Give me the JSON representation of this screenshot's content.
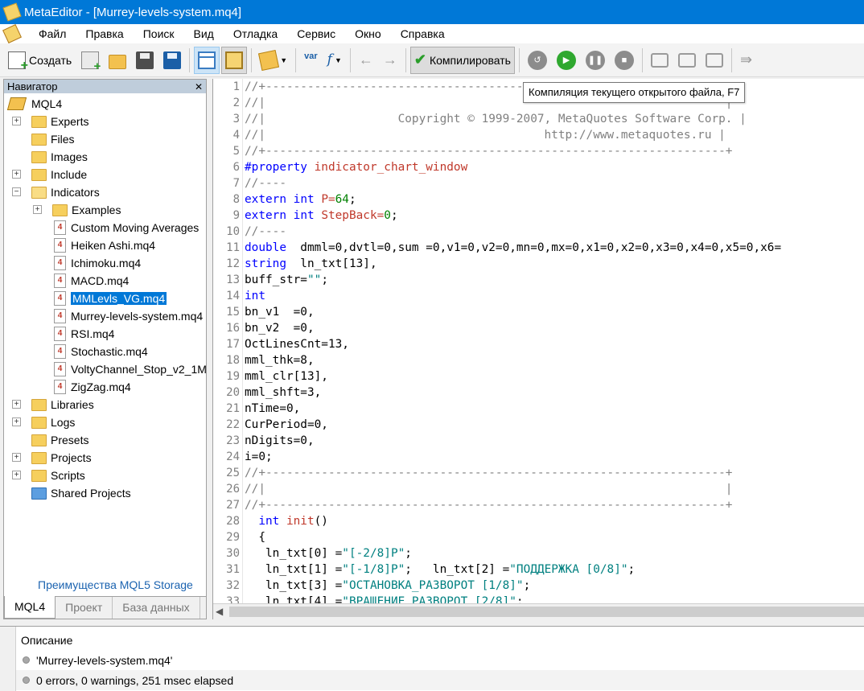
{
  "titlebar": {
    "title": "MetaEditor - [Murrey-levels-system.mq4]"
  },
  "menu": [
    "Файл",
    "Правка",
    "Поиск",
    "Вид",
    "Отладка",
    "Сервис",
    "Окно",
    "Справка"
  ],
  "toolbar": {
    "create_label": "Создать",
    "compile_label": "Компилировать",
    "tooltip": "Компиляция текущего открытого файла, F7",
    "var_label": "var",
    "func_label": "f"
  },
  "navigator": {
    "title": "Навигатор",
    "root": "MQL4",
    "folders": {
      "experts": "Experts",
      "files": "Files",
      "images": "Images",
      "include": "Include",
      "indicators": "Indicators",
      "examples": "Examples",
      "libraries": "Libraries",
      "logs": "Logs",
      "presets": "Presets",
      "projects": "Projects",
      "scripts": "Scripts",
      "shared_projects": "Shared Projects"
    },
    "indicator_files": [
      "Custom Moving Averages",
      "Heiken Ashi.mq4",
      "Ichimoku.mq4",
      "MACD.mq4",
      "MMLevls_VG.mq4",
      "Murrey-levels-system.mq4",
      "RSI.mq4",
      "Stochastic.mq4",
      "VoltyChannel_Stop_v2_1M",
      "ZigZag.mq4"
    ],
    "file_icon_char": "4",
    "storage_link": "Преимущества MQL5 Storage",
    "tabs": [
      "MQL4",
      "Проект",
      "База данных"
    ]
  },
  "editor": {
    "line_numbers": [
      "1",
      "2",
      "3",
      "4",
      "5",
      "6",
      "7",
      "8",
      "9",
      "10",
      "11",
      "12",
      "13",
      "14",
      "15",
      "16",
      "17",
      "18",
      "19",
      "20",
      "21",
      "22",
      "23",
      "24",
      "25",
      "26",
      "27",
      "28",
      "29",
      "30",
      "31",
      "32",
      "33"
    ],
    "code": {
      "l1": "//+------------------------------------------------------------------+",
      "l2": "//|                                                                  |",
      "l3": "//|                   Copyright © 1999-2007, MetaQuotes Software Corp. |",
      "l4": "//|                                        http://www.metaquotes.ru |",
      "l5": "//+------------------------------------------------------------------+",
      "l6a": "#property ",
      "l6b": "indicator_chart_window",
      "l7": "//----",
      "l8a": "extern ",
      "l8b": "int ",
      "l8c": "P=",
      "l8d": "64",
      "l8e": ";",
      "l9a": "extern ",
      "l9b": "int ",
      "l9c": "StepBack=",
      "l9d": "0",
      "l9e": ";",
      "l10": "//----",
      "l11a": "double",
      "l11b": "  dmml=0,dvtl=0,sum =0,v1=0,v2=0,mn=0,mx=0,x1=0,x2=0,x3=0,x4=0,x5=0,x6=",
      "l12a": "string",
      "l12b": "  ln_txt[13],",
      "l13a": "buff_str=",
      "l13b": "\"\"",
      "l13c": ";",
      "l14": "int",
      "l15": "bn_v1  =0,",
      "l16": "bn_v2  =0,",
      "l17": "OctLinesCnt=13,",
      "l18": "mml_thk=8,",
      "l19": "mml_clr[13],",
      "l20": "mml_shft=3,",
      "l21": "nTime=0,",
      "l22": "CurPeriod=0,",
      "l23": "nDigits=0,",
      "l24": "i=0;",
      "l25": "//+------------------------------------------------------------------+",
      "l26": "//|                                                                  |",
      "l27": "//+------------------------------------------------------------------+",
      "l28a": "  int ",
      "l28b": "init",
      "l28c": "()",
      "l29": "  {",
      "l30a": "   ln_txt[0] =",
      "l30b": "\"[-2/8]P\"",
      "l30c": ";",
      "l31a": "   ln_txt[1] =",
      "l31b": "\"[-1/8]P\"",
      "l31c": ";   ln_txt[2] =",
      "l31d": "\"ПОДДЕРЖКА [0/8]\"",
      "l31e": ";",
      "l32a": "   ln_txt[3] =",
      "l32b": "\"ОСТАНОВКА_РАЗВОРОТ [1/8]\"",
      "l32c": ";",
      "l33a": "   ln_txt[4] =",
      "l33b": "\"ВРАЩЕНИЕ_РАЗВОРОТ [2/8]\"",
      "l33c": ";"
    }
  },
  "toolbox": {
    "header": "Описание",
    "rows": [
      "'Murrey-levels-system.mq4'",
      "0 errors, 0 warnings, 251 msec elapsed"
    ]
  }
}
